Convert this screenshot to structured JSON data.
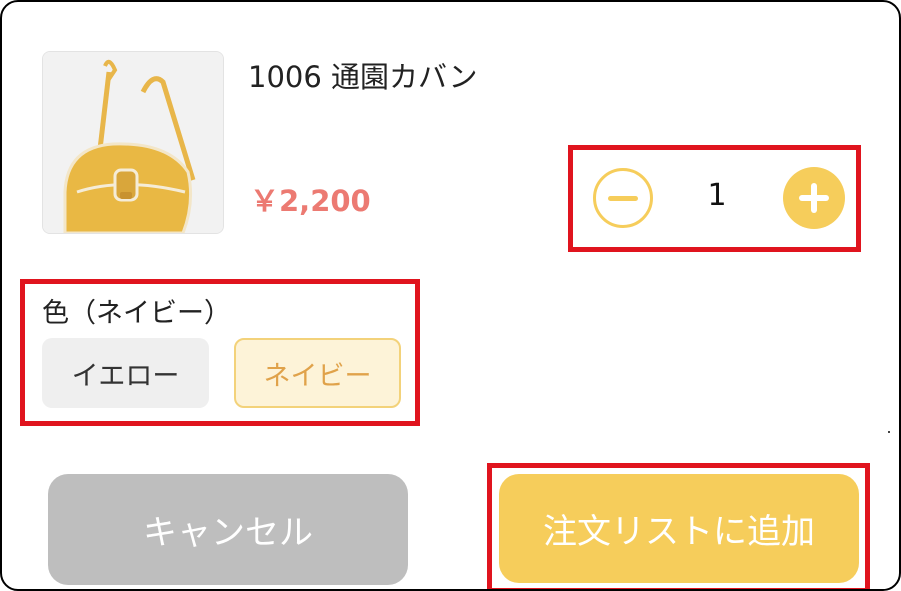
{
  "product": {
    "title": "1006 通園カバン",
    "price": "￥2,200",
    "image_icon": "yellow-shoulder-bag-image"
  },
  "quantity": {
    "value": "1",
    "minus_icon": "minus-circle-icon",
    "plus_icon": "plus-circle-icon"
  },
  "color": {
    "label": "色（ネイビー）",
    "options": [
      {
        "label": "イエロー",
        "selected": false
      },
      {
        "label": "ネイビー",
        "selected": true
      }
    ]
  },
  "actions": {
    "cancel_label": "キャンセル",
    "add_label": "注文リストに追加"
  },
  "theme": {
    "accent": "#f6cd5b",
    "price_color": "#ec7a72",
    "highlight": "#e0141e",
    "cancel_bg": "#bebebe",
    "selected_bg": "#fdf3d8",
    "selected_text": "#e0a24a"
  }
}
